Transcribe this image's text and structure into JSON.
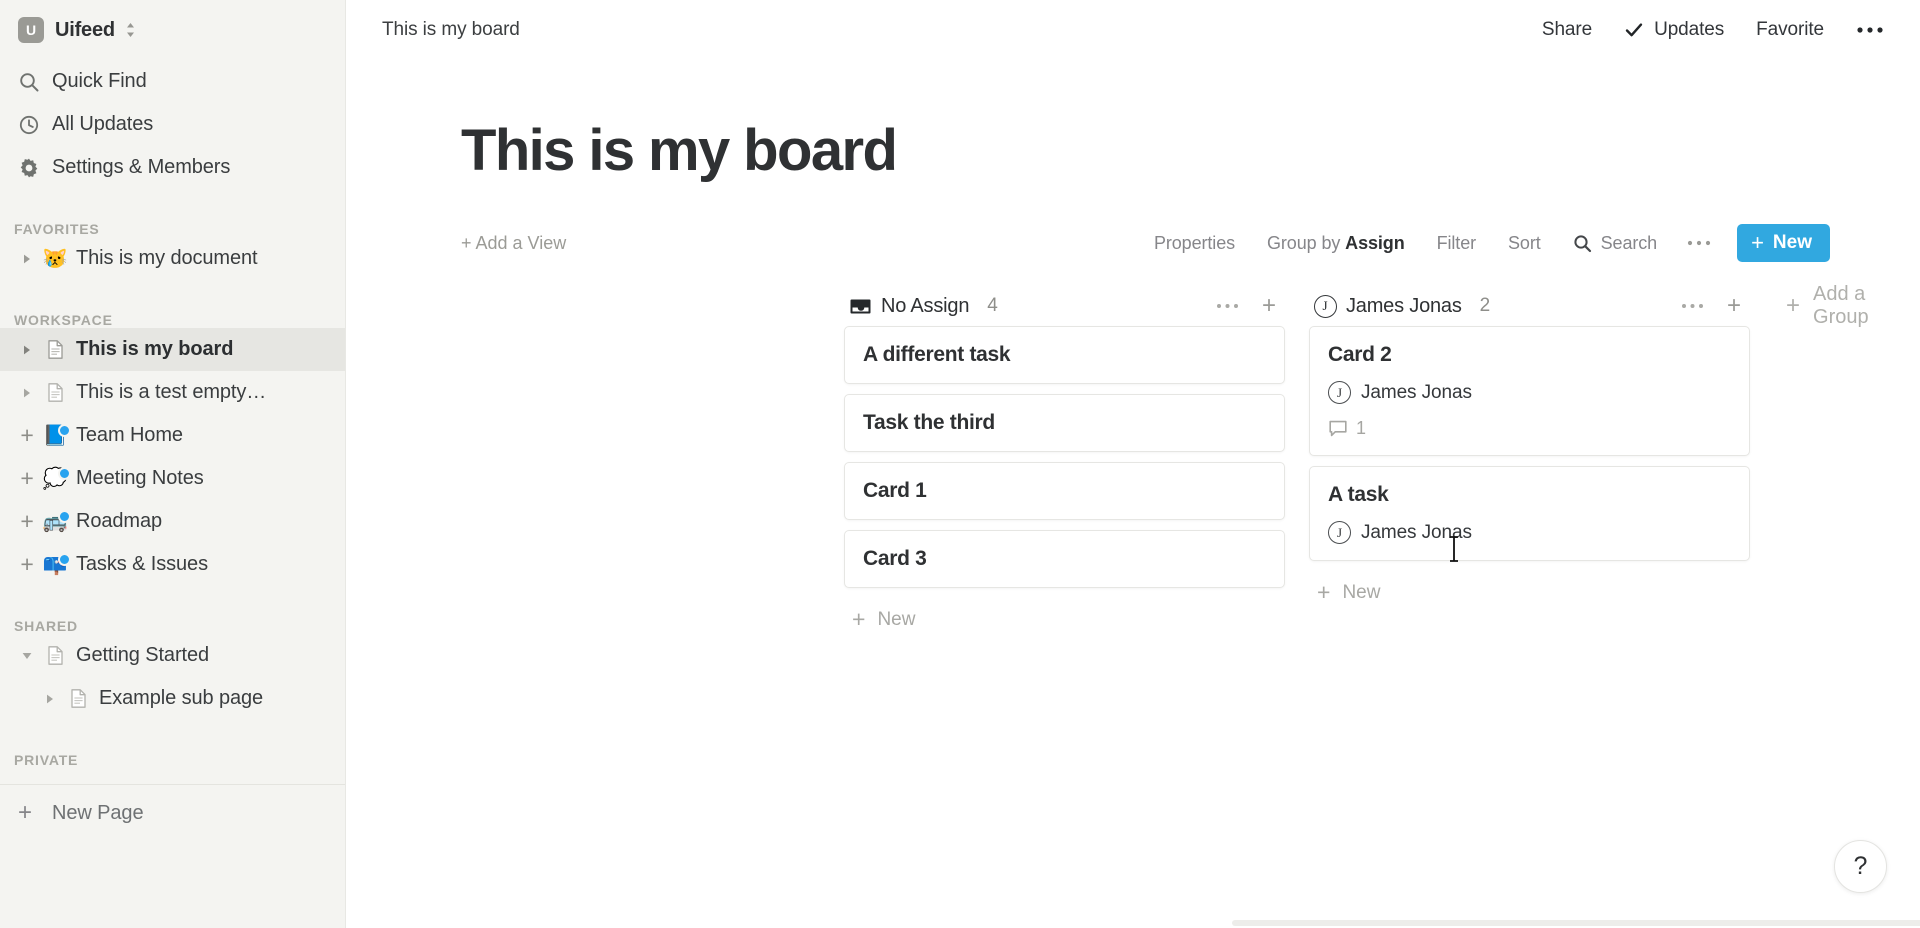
{
  "workspace": {
    "logo_letter": "U",
    "name": "Uifeed",
    "switcher_icon": "chevron-updown-icon"
  },
  "sidebar": {
    "nav": [
      {
        "label": "Quick Find",
        "icon": "search-icon"
      },
      {
        "label": "All Updates",
        "icon": "clock-icon"
      },
      {
        "label": "Settings & Members",
        "icon": "gear-icon"
      }
    ],
    "sections": [
      {
        "title": "FAVORITES",
        "items": [
          {
            "label": "This is my document",
            "emoji": "😿",
            "icon": "emoji-page-icon",
            "twisty": "collapsed",
            "badge": false,
            "active": false,
            "indent": false
          }
        ]
      },
      {
        "title": "WORKSPACE",
        "items": [
          {
            "label": "This is my board",
            "emoji": "",
            "icon": "page-icon",
            "twisty": "collapsed",
            "badge": false,
            "active": true,
            "indent": false
          },
          {
            "label": "This is a test empty…",
            "emoji": "",
            "icon": "page-icon",
            "twisty": "collapsed",
            "badge": false,
            "active": false,
            "indent": false
          },
          {
            "label": "Team Home",
            "emoji": "📘",
            "icon": "emoji-page-icon",
            "twisty": "plus",
            "badge": true,
            "active": false,
            "indent": false
          },
          {
            "label": "Meeting Notes",
            "emoji": "💭",
            "icon": "emoji-page-icon",
            "twisty": "plus",
            "badge": true,
            "active": false,
            "indent": false
          },
          {
            "label": "Roadmap",
            "emoji": "🚌",
            "icon": "emoji-page-icon",
            "twisty": "plus",
            "badge": true,
            "active": false,
            "indent": false
          },
          {
            "label": "Tasks & Issues",
            "emoji": "📪",
            "icon": "emoji-page-icon",
            "twisty": "plus",
            "badge": true,
            "active": false,
            "indent": false
          }
        ]
      },
      {
        "title": "SHARED",
        "items": [
          {
            "label": "Getting Started",
            "emoji": "",
            "icon": "page-icon",
            "twisty": "expanded",
            "badge": false,
            "active": false,
            "indent": false
          },
          {
            "label": "Example sub page",
            "emoji": "",
            "icon": "page-icon",
            "twisty": "collapsed",
            "badge": false,
            "active": false,
            "indent": true
          }
        ]
      },
      {
        "title": "PRIVATE",
        "items": []
      }
    ],
    "new_page": {
      "label": "New Page",
      "icon": "plus-icon"
    }
  },
  "topbar": {
    "breadcrumb": "This is my board",
    "share_label": "Share",
    "updates_label": "Updates",
    "updates_icon": "check-icon",
    "favorite_label": "Favorite",
    "more_icon": "ellipsis-icon"
  },
  "page": {
    "title": "This is my board"
  },
  "viewbar": {
    "add_view": "+ Add a View",
    "properties": "Properties",
    "group_by_prefix": "Group by",
    "group_by_value": "Assign",
    "filter": "Filter",
    "sort": "Sort",
    "search": "Search",
    "search_icon": "search-icon",
    "more_icon": "ellipsis-icon",
    "new_button": "New",
    "new_button_plus": "+",
    "accent_color": "#31a8e0"
  },
  "board": {
    "add_group_label": "Add a Group",
    "new_card_label": "New",
    "columns": [
      {
        "name": "No Assign",
        "count": "4",
        "icon": "inbox-icon",
        "avatar_letter": "",
        "cards": [
          {
            "title": "A different task",
            "assignee": "",
            "avatar_letter": "",
            "comments": ""
          },
          {
            "title": "Task the third",
            "assignee": "",
            "avatar_letter": "",
            "comments": ""
          },
          {
            "title": "Card 1",
            "assignee": "",
            "avatar_letter": "",
            "comments": ""
          },
          {
            "title": "Card 3",
            "assignee": "",
            "avatar_letter": "",
            "comments": ""
          }
        ]
      },
      {
        "name": "James Jonas",
        "count": "2",
        "icon": "avatar-icon",
        "avatar_letter": "J",
        "cards": [
          {
            "title": "Card 2",
            "assignee": "James Jonas",
            "avatar_letter": "J",
            "comments": "1"
          },
          {
            "title": "A task",
            "assignee": "James Jonas",
            "avatar_letter": "J",
            "comments": ""
          }
        ]
      }
    ]
  },
  "help": {
    "label": "?"
  }
}
